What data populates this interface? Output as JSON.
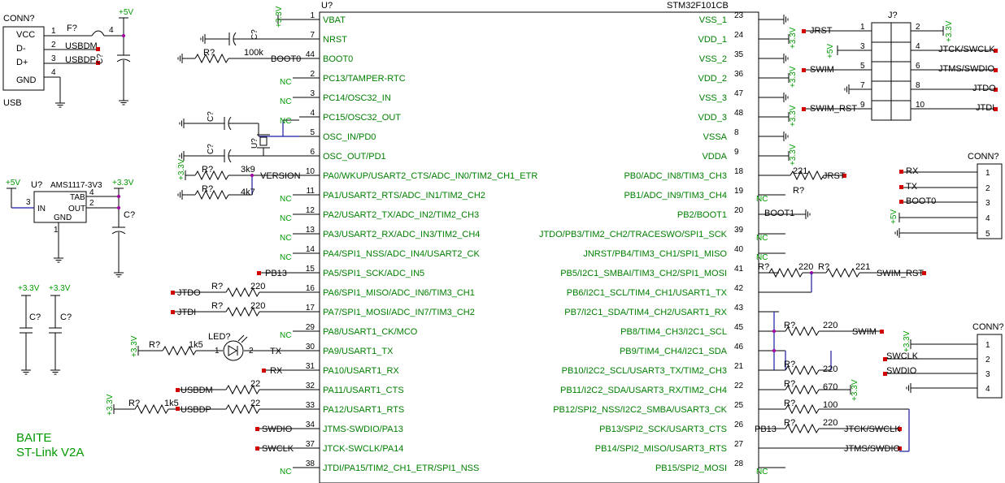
{
  "mcu": {
    "ref": "U?",
    "part": "STM32F101CB",
    "left_pins": [
      {
        "num": "1",
        "name": "VBAT"
      },
      {
        "num": "7",
        "name": "NRST"
      },
      {
        "num": "44",
        "name": "BOOT0"
      },
      {
        "num": "2",
        "name": "PC13/TAMPER-RTC"
      },
      {
        "num": "3",
        "name": "PC14/OSC32_IN"
      },
      {
        "num": "4",
        "name": "PC15/OSC32_OUT"
      },
      {
        "num": "5",
        "name": "OSC_IN/PD0"
      },
      {
        "num": "6",
        "name": "OSC_OUT/PD1"
      },
      {
        "num": "10",
        "name": "PA0/WKUP/USART2_CTS/ADC_IN0/TIM2_CH1_ETR"
      },
      {
        "num": "11",
        "name": "PA1/USART2_RTS/ADC_IN1/TIM2_CH2"
      },
      {
        "num": "12",
        "name": "PA2/USART2_TX/ADC_IN2/TIM2_CH3"
      },
      {
        "num": "13",
        "name": "PA3/USART2_RX/ADC_IN3/TIM2_CH4"
      },
      {
        "num": "14",
        "name": "PA4/SPI1_NSS/ADC_IN4/USART2_CK"
      },
      {
        "num": "15",
        "name": "PA5/SPI1_SCK/ADC_IN5"
      },
      {
        "num": "16",
        "name": "PA6/SPI1_MISO/ADC_IN6/TIM3_CH1"
      },
      {
        "num": "17",
        "name": "PA7/SPI1_MOSI/ADC_IN7/TIM3_CH2"
      },
      {
        "num": "29",
        "name": "PA8/USART1_CK/MCO"
      },
      {
        "num": "30",
        "name": "PA9/USART1_TX"
      },
      {
        "num": "31",
        "name": "PA10/USART1_RX"
      },
      {
        "num": "32",
        "name": "PA11/USART1_CTS"
      },
      {
        "num": "33",
        "name": "PA12/USART1_RTS"
      },
      {
        "num": "34",
        "name": "JTMS-SWDIO/PA13"
      },
      {
        "num": "37",
        "name": "JTCK-SWCLK/PA14"
      },
      {
        "num": "38",
        "name": "JTDI/PA15/TIM2_CH1_ETR/SPI1_NSS"
      }
    ],
    "right_pins": [
      {
        "num": "23",
        "name": "VSS_1"
      },
      {
        "num": "24",
        "name": "VDD_1"
      },
      {
        "num": "35",
        "name": "VSS_2"
      },
      {
        "num": "36",
        "name": "VDD_2"
      },
      {
        "num": "47",
        "name": "VSS_3"
      },
      {
        "num": "48",
        "name": "VDD_3"
      },
      {
        "num": "8",
        "name": "VSSA"
      },
      {
        "num": "9",
        "name": "VDDA"
      },
      {
        "num": "18",
        "name": "PB0/ADC_IN8/TIM3_CH3"
      },
      {
        "num": "19",
        "name": "PB1/ADC_IN9/TIM3_CH4"
      },
      {
        "num": "20",
        "name": "PB2/BOOT1"
      },
      {
        "num": "39",
        "name": "JTDO/PB3/TIM2_CH2/TRACESWO/SPI1_SCK"
      },
      {
        "num": "40",
        "name": "JNRST/PB4/TIM3_CH1/SPI1_MISO"
      },
      {
        "num": "41",
        "name": "PB5/I2C1_SMBAI/TIM3_CH2/SPI1_MOSI"
      },
      {
        "num": "42",
        "name": "PB6/I2C1_SCL/TIM4_CH1/USART1_TX"
      },
      {
        "num": "43",
        "name": "PB7/I2C1_SDA/TIM4_CH2/USART1_RX"
      },
      {
        "num": "45",
        "name": "PB8/TIM4_CH3/I2C1_SCL"
      },
      {
        "num": "46",
        "name": "PB9/TIM4_CH4/I2C1_SDA"
      },
      {
        "num": "21",
        "name": "PB10/I2C2_SCL/USART3_TX/TIM2_CH3"
      },
      {
        "num": "22",
        "name": "PB11/I2C2_SDA/USART3_RX/TIM2_CH4"
      },
      {
        "num": "25",
        "name": "PB12/SPI2_NSS/I2C2_SMBA/USART3_CK"
      },
      {
        "num": "26",
        "name": "PB13/SPI2_SCK/USART3_CTS"
      },
      {
        "num": "27",
        "name": "PB14/SPI2_MISO/USART3_RTS"
      },
      {
        "num": "28",
        "name": "PB15/SPI2_MOSI"
      }
    ]
  },
  "usb": {
    "ref": "CONN?",
    "label": "USB",
    "pins": [
      {
        "num": "1",
        "name": "VCC"
      },
      {
        "num": "2",
        "name": "D-"
      },
      {
        "num": "3",
        "name": "D+"
      },
      {
        "num": "4",
        "name": "GND"
      }
    ],
    "fuse": "F?",
    "fuse_pin": "4",
    "net_dm": "USBDM",
    "net_dp": "USBDP",
    "cap": "C?",
    "supply": "+5V"
  },
  "regulator": {
    "ref": "U?",
    "part": "AMS1117-3V3",
    "pin_in": "IN",
    "pin_gnd": "GND",
    "pin_tab": "TAB",
    "pin_out": "OUT",
    "num_in": "3",
    "num_gnd": "1",
    "num_tab": "4",
    "num_out": "2",
    "in_supply": "+5V",
    "out_supply": "+3.3V",
    "cap": "C?"
  },
  "decoupling": {
    "supply_a": "+3.3V",
    "supply_b": "+3.3V",
    "cap_a": "C?",
    "cap_b": "C?"
  },
  "jtag": {
    "ref": "J?",
    "left": [
      {
        "num": "1",
        "net": "JRST"
      },
      {
        "num": "3",
        "net": ""
      },
      {
        "num": "5",
        "net": "SWIM"
      },
      {
        "num": "7",
        "net": ""
      },
      {
        "num": "9",
        "net": "SWIM_RST"
      }
    ],
    "right": [
      {
        "num": "2",
        "net": ""
      },
      {
        "num": "4",
        "net": "JTCK/SWCLK"
      },
      {
        "num": "6",
        "net": "JTMS/SWDIO"
      },
      {
        "num": "8",
        "net": "JTDO"
      },
      {
        "num": "10",
        "net": "JTDI"
      }
    ],
    "supply_pin3": "+5V",
    "supply_pin2": "+3.3V"
  },
  "conn_uart": {
    "ref": "CONN?",
    "nets": [
      "RX",
      "TX",
      "BOOT0",
      "",
      ""
    ],
    "pins": [
      "1",
      "2",
      "3",
      "4",
      "5"
    ],
    "supply": "+5V"
  },
  "conn_swd": {
    "ref": "CONN?",
    "nets": [
      "",
      "SWCLK",
      "SWDIO",
      ""
    ],
    "pins": [
      "1",
      "2",
      "3",
      "4"
    ],
    "supply": "+3.3V"
  },
  "passives": {
    "r_boot0": "R?",
    "r_boot0_val": "100k",
    "net_boot0": "BOOT0",
    "c_nrst": "C?",
    "c_osc_a": "C?",
    "c_osc_b": "C?",
    "crystal": "U?",
    "r_version_a": "R?",
    "r_version_a_val": "3k9",
    "net_version": "VERSION",
    "r_version_b": "R?",
    "r_version_b_val": "4k7",
    "net_pb13_a": "PB13",
    "r_jtdo": "R?",
    "r_jtdo_val": "220",
    "net_jtdo": "JTDO",
    "r_jtdi": "R?",
    "r_jtdi_val": "220",
    "net_jtdi": "JTDI",
    "r_led": "R?",
    "r_led_val": "1k5",
    "led": "LED?",
    "led_pin1": "1",
    "led_pin2": "2",
    "net_tx": "TX",
    "net_rx": "RX",
    "r_usbdm": "22",
    "net_usbdm": "USBDM",
    "r_usbdp": "22",
    "net_usbdp": "USBDP",
    "r_pullup": "R?",
    "r_pullup_val": "1k5",
    "net_swdio": "SWDIO",
    "net_swclk": "SWCLK",
    "nc": "NC",
    "supply_33": "+3.3V",
    "r_jrst": "221",
    "r_jrst_ref": "R?",
    "net_jrst": "JRST",
    "net_boot1": "BOOT1",
    "r_pb5_a": "R?",
    "r_pb5_a_val": "220",
    "r_pb5_b": "R?",
    "r_pb5_b_val": "221",
    "net_swim_rst": "SWIM_RST",
    "r_swim": "R?",
    "r_swim_val": "220",
    "net_swim": "SWIM",
    "r_pb10": "R?",
    "r_pb10_val": "220",
    "r_pb11": "R?",
    "r_pb11_val": "670",
    "r_pb12": "R?",
    "r_pb12_val": "100",
    "r_pb13": "R?",
    "r_pb13_val": "220",
    "net_pb13_b": "PB13",
    "net_jtck_swclk": "JTCK/SWCLK",
    "net_jtms_swdio": "JTMS/SWDIO"
  },
  "title_block": {
    "line1": "BAITE",
    "line2": "ST-Link V2A"
  }
}
